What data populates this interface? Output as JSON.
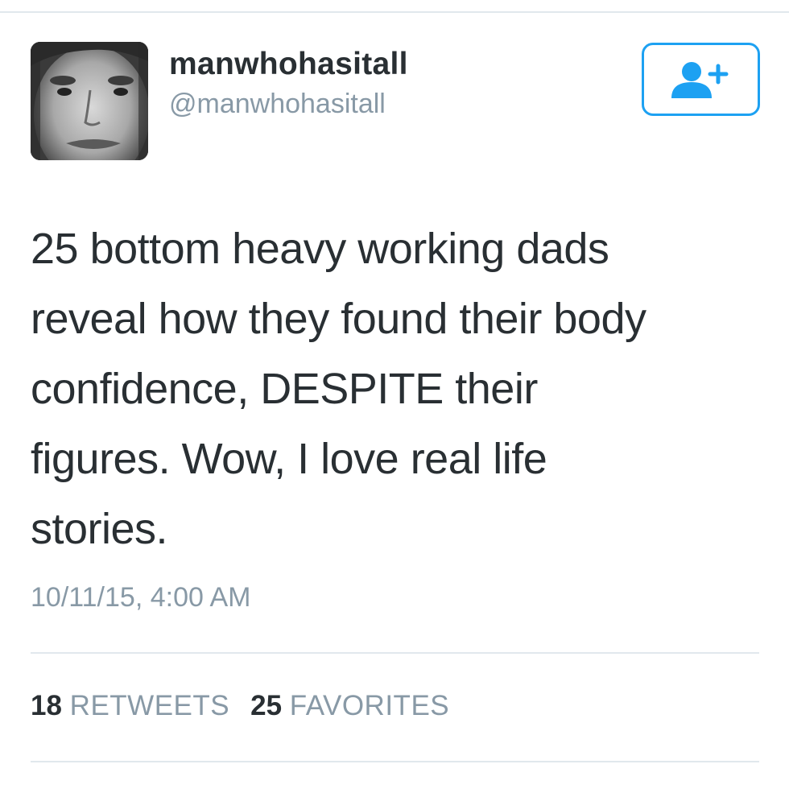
{
  "user": {
    "display_name": "manwhohasitall",
    "handle": "@manwhohasitall",
    "avatar_icon": "profile-photo"
  },
  "follow_button": {
    "icon": "add-user-icon",
    "accent": "#1da1f2"
  },
  "tweet": {
    "lines": [
      "25 bottom heavy working dads",
      "reveal how they found their body",
      "confidence, DESPITE their",
      "figures. Wow, I love real life",
      "stories."
    ],
    "timestamp": "10/11/15, 4:00 AM"
  },
  "stats": {
    "retweets_count": "18",
    "retweets_label": "RETWEETS",
    "favorites_count": "25",
    "favorites_label": "FAVORITES"
  },
  "colors": {
    "text": "#292f33",
    "muted": "#8899a6",
    "divider": "#e1e8ed",
    "accent": "#1da1f2"
  }
}
